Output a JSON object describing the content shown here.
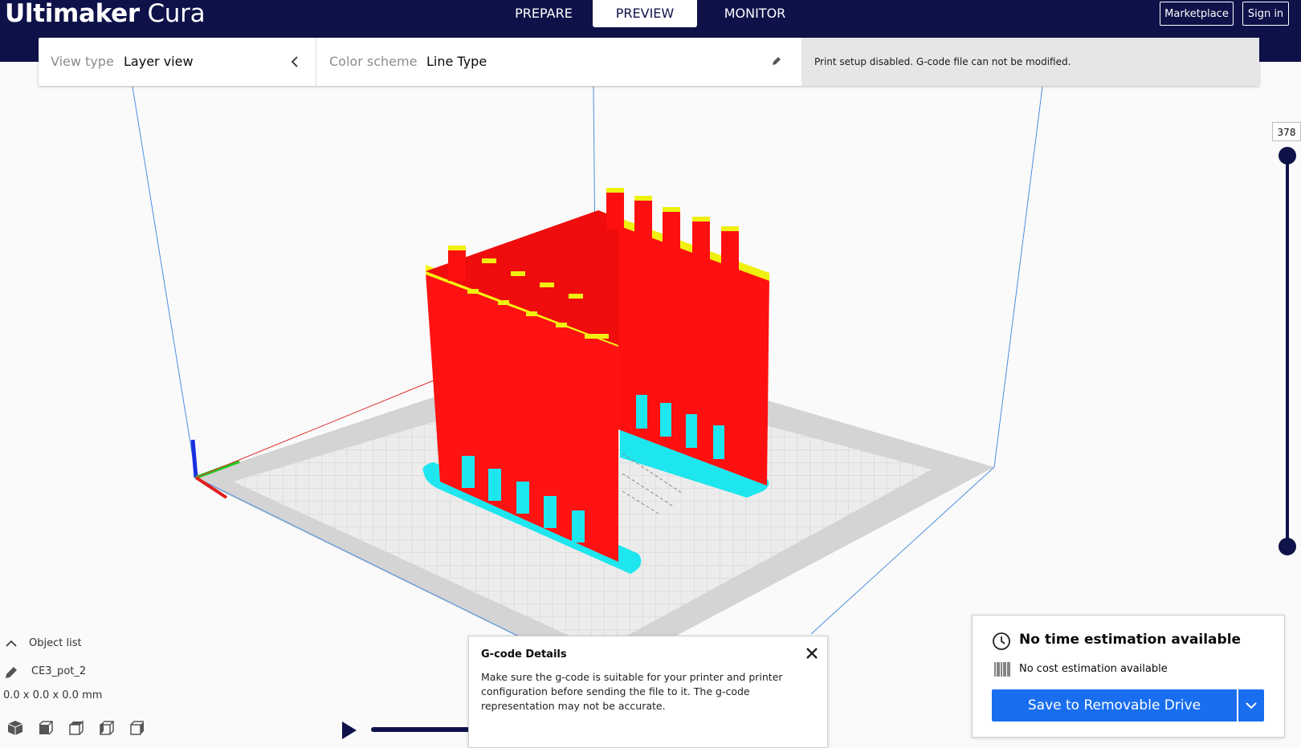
{
  "app": {
    "brand_bold": "Ultimaker",
    "brand_light": "Cura"
  },
  "nav": {
    "tabs": [
      {
        "label": "PREPARE"
      },
      {
        "label": "PREVIEW"
      },
      {
        "label": "MONITOR"
      }
    ],
    "active": "PREVIEW"
  },
  "top_buttons": {
    "marketplace": "Marketplace",
    "sign_in": "Sign in"
  },
  "header": {
    "view_type_label": "View type",
    "view_type_value": "Layer view",
    "color_scheme_label": "Color scheme",
    "color_scheme_value": "Line Type",
    "notice": "Print setup disabled. G-code file can not be modified."
  },
  "layer_slider": {
    "current_layer": "378"
  },
  "object_list": {
    "toggle_label": "Object list",
    "object_name": "CE3_pot_2",
    "dimensions": "0.0 x 0.0 x 0.0 mm"
  },
  "view_icons": [
    "3d-view-icon",
    "front-view-icon",
    "top-view-icon",
    "left-view-icon",
    "right-view-icon"
  ],
  "gcode_details": {
    "title": "G-code Details",
    "body": "Make sure the g-code is suitable for your printer and printer configuration before sending the file to it. The g-code representation may not be accurate."
  },
  "action_panel": {
    "time_estimate": "No time estimation available",
    "cost_estimate": "No cost estimation available",
    "save_button": "Save to Removable Drive"
  },
  "colors": {
    "topbar": "#0f1249",
    "wall_outer": "#ff0000",
    "wall_inner": "#ffff00",
    "skirt": "#00ffff",
    "accent_button": "#196ef0"
  }
}
